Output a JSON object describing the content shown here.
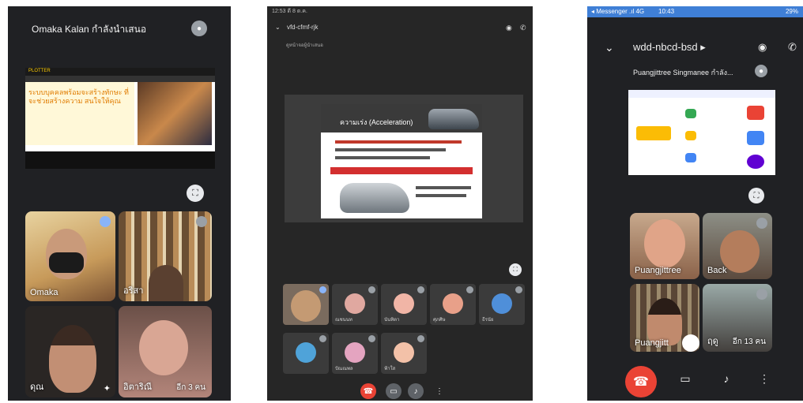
{
  "phone_a": {
    "presenter_text": "Omaka Kalan กำลังนำเสนอ",
    "site_logo": "PLOTTER",
    "hero_text": "ระบบบุคคลพร้อมจะสร้างทักษะ ที่จะช่วยสร้างความ สนใจให้คุณ",
    "tiles": [
      {
        "name": "Omaka",
        "color": "#d7b26a"
      },
      {
        "name": "อริสา",
        "color": "#8c6b3f"
      },
      {
        "name": "ดุณ",
        "color": "#5b4d45"
      },
      {
        "name": "อิตาริณี",
        "more": "อีก 3 คน",
        "color": "#9a6e5a"
      }
    ]
  },
  "phone_b": {
    "status": "12:53 ดี 8 ต.ค.",
    "meeting": "vfd-cfmf-rjk",
    "sub": "ดูหน้าจอผู้นำเสนอ",
    "slide_title": "ความเร่ง (Acceleration)",
    "tiles": [
      {
        "label": "",
        "color": "#c49a73"
      },
      {
        "label": "ณชนนท",
        "color": "#e0a8a0"
      },
      {
        "label": "นันทิตา",
        "color": "#f1b5a6"
      },
      {
        "label": "ศุภศิษ",
        "color": "#e8a089"
      },
      {
        "label": "ธีรนัย",
        "color": "#4f8fd9"
      },
      {
        "label": "",
        "color": "#4fa3d9"
      },
      {
        "label": "ปัณณพล",
        "color": "#e4a4c0"
      },
      {
        "label": "ฟ้าใส",
        "color": "#f3c1a8"
      }
    ]
  },
  "phone_c": {
    "status_left": "◂ Messenger .ıl 4G",
    "status_mid": "10:43",
    "status_right": "29%",
    "meeting_code": "wdd-nbcd-bsd ▸",
    "presenter": "Puangjittree Singmanee กำลัง...",
    "tiles": [
      {
        "name": "Puangjittree",
        "color": "#c58d6a"
      },
      {
        "name": "Back",
        "color": "#a06e4f"
      },
      {
        "name": "Puangjitt",
        "color": "#5a4033"
      },
      {
        "name": "ฤดู",
        "more": "อีก 13 คน",
        "color": "#7b8a8a"
      }
    ]
  },
  "icons": {
    "expand": "⛶",
    "chevron": "⌄",
    "camera_switch": "◉",
    "speaker": "✆",
    "hangup": "☎",
    "video": "▭",
    "mic": "♪",
    "more": "⋮"
  },
  "colors": {
    "hangup": "#ea4335",
    "accent_blue": "#8ab4f8"
  }
}
